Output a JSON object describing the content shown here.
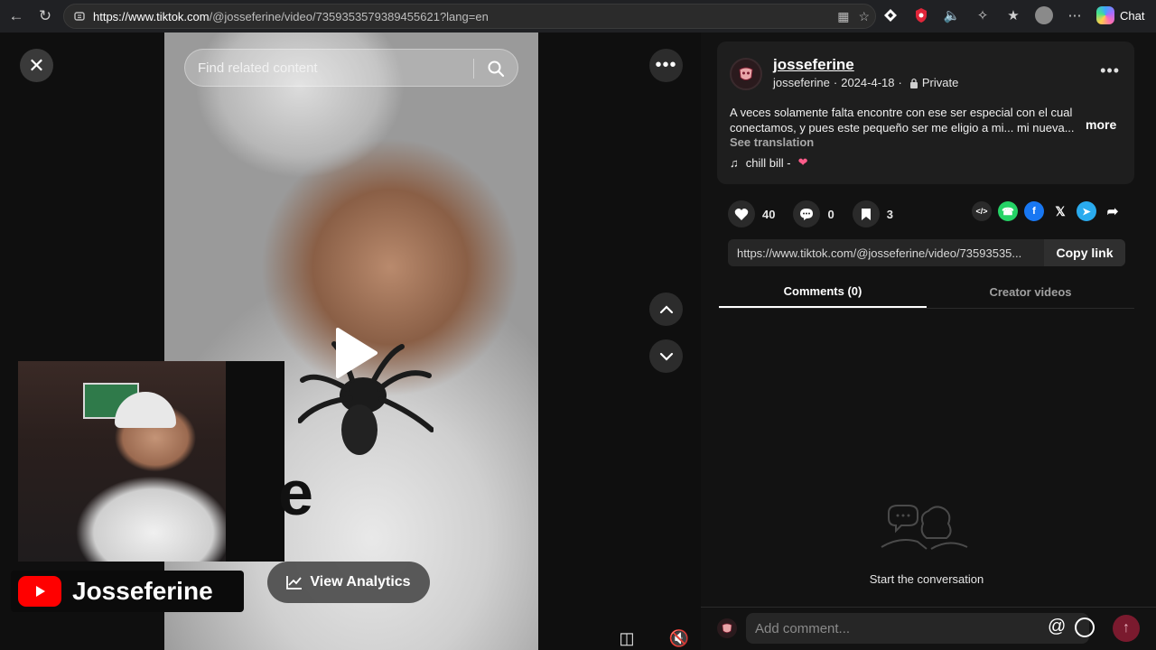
{
  "browser": {
    "url_host": "https://www.tiktok.com",
    "url_path": "/@josseferine/video/7359353579389455621?lang=en",
    "chat_label": "Chat"
  },
  "stage": {
    "search_placeholder": "Find related content",
    "analytics_label": "View Analytics",
    "channel_name": "Josseferine",
    "overlay_letter": "e"
  },
  "post": {
    "author": "josseferine",
    "username": "josseferine",
    "date": "2024-4-18",
    "separator": "·",
    "privacy": "Private",
    "description": "A veces solamente falta encontre con ese ser especial con el cual conectamos, y pues este pequeño ser me eligio a mi... mi nueva...",
    "more_label": "more",
    "translation_label": "See translation",
    "music": "chill bill -",
    "likes": "40",
    "comments": "0",
    "saves": "3",
    "link": "https://www.tiktok.com/@josseferine/video/73593535...",
    "copy_label": "Copy link"
  },
  "tabs": [
    {
      "label": "Comments (0)",
      "active": true
    },
    {
      "label": "Creator videos",
      "active": false
    }
  ],
  "empty_state": {
    "text": "Start the conversation"
  },
  "comment_box": {
    "placeholder": "Add comment..."
  },
  "colors": {
    "accent": "#fe2c55",
    "whatsapp": "#25d366",
    "facebook": "#1877f2",
    "telegram": "#2aabee"
  }
}
